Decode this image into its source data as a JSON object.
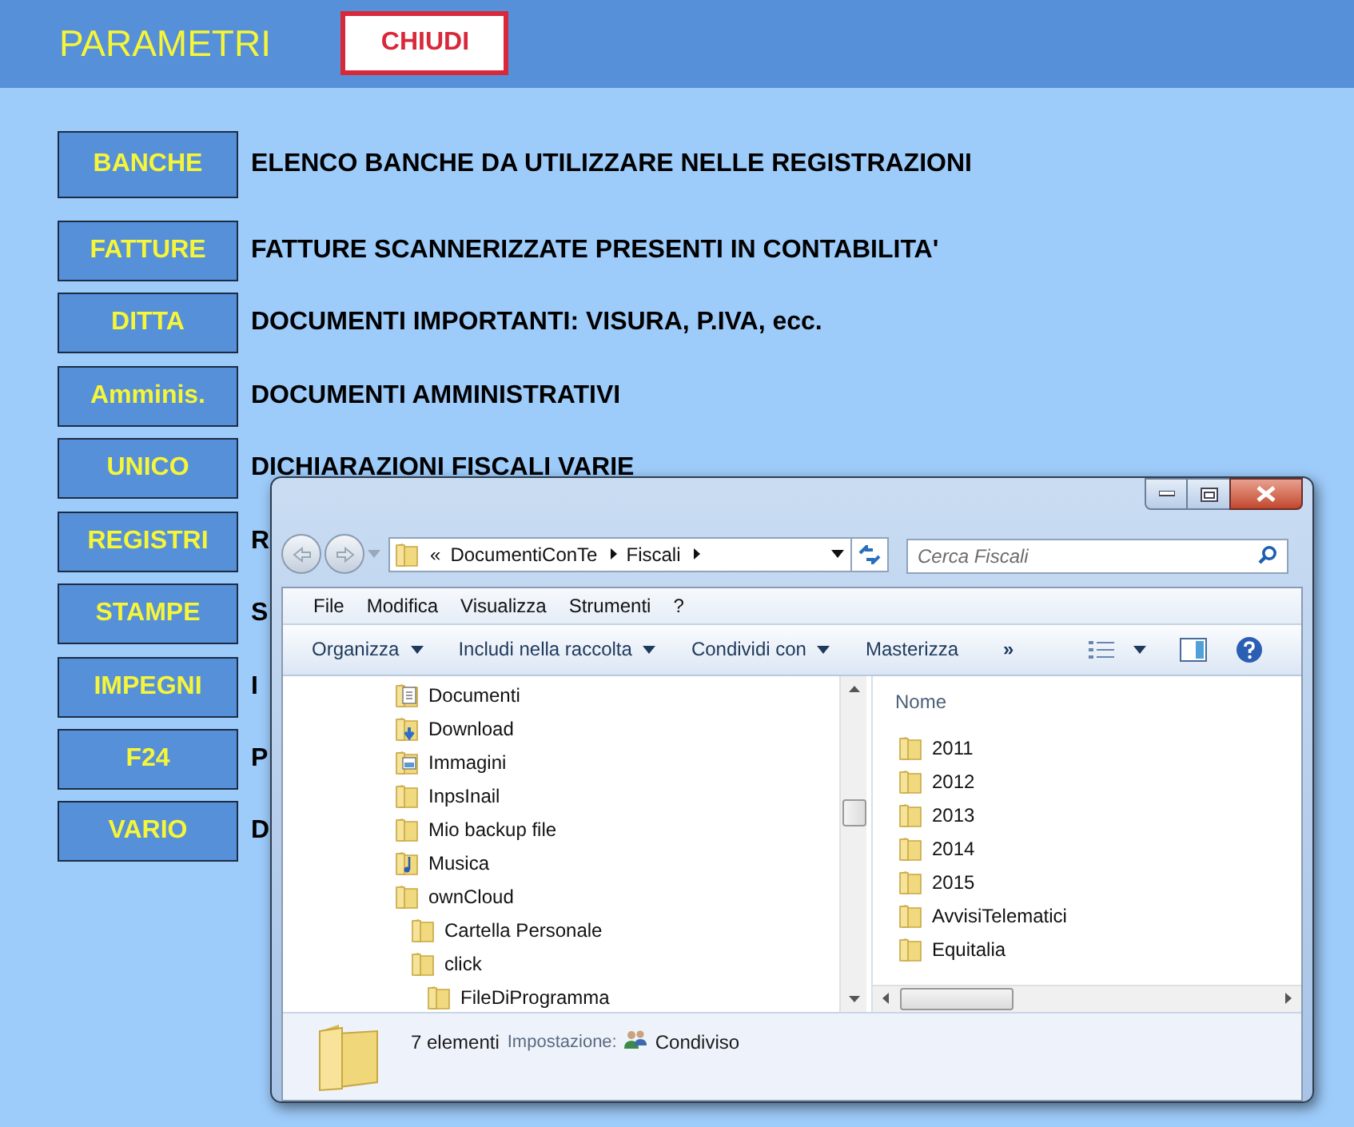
{
  "header": {
    "title": "PARAMETRI",
    "close_button": "CHIUDI"
  },
  "sections": [
    {
      "button": "BANCHE",
      "description": "ELENCO BANCHE DA UTILIZZARE NELLE REGISTRAZIONI"
    },
    {
      "button": "FATTURE",
      "description": "FATTURE SCANNERIZZATE PRESENTI IN CONTABILITA'"
    },
    {
      "button": "DITTA",
      "description": "DOCUMENTI IMPORTANTI: VISURA, P.IVA, ecc."
    },
    {
      "button": "Amminis.",
      "description": "DOCUMENTI AMMINISTRATIVI"
    },
    {
      "button": "UNICO",
      "description": "DICHIARAZIONI FISCALI VARIE"
    },
    {
      "button": "REGISTRI",
      "description": "R"
    },
    {
      "button": "STAMPE",
      "description": "S"
    },
    {
      "button": "IMPEGNI",
      "description": "I"
    },
    {
      "button": "F24",
      "description": "P"
    },
    {
      "button": "VARIO",
      "description": "D"
    }
  ],
  "explorer": {
    "breadcrumb": {
      "overflow": "«",
      "segments": [
        "DocumentiConTe",
        "Fiscali"
      ]
    },
    "search": {
      "placeholder": "Cerca Fiscali"
    },
    "menu": [
      "File",
      "Modifica",
      "Visualizza",
      "Strumenti",
      "?"
    ],
    "toolbar": [
      {
        "label": "Organizza",
        "dropdown": true
      },
      {
        "label": "Includi nella raccolta",
        "dropdown": true
      },
      {
        "label": "Condividi con",
        "dropdown": true
      },
      {
        "label": "Masterizza",
        "dropdown": false
      }
    ],
    "more": "»",
    "nav_tree": [
      {
        "label": "Documenti",
        "kind": "documents"
      },
      {
        "label": "Download",
        "kind": "downloads"
      },
      {
        "label": "Immagini",
        "kind": "pictures"
      },
      {
        "label": "InpsInail",
        "kind": "folder"
      },
      {
        "label": "Mio backup file",
        "kind": "folder"
      },
      {
        "label": "Musica",
        "kind": "music"
      },
      {
        "label": "ownCloud",
        "kind": "folder",
        "children": [
          {
            "label": "Cartella Personale"
          },
          {
            "label": "click",
            "children": [
              {
                "label": "FileDiProgramma"
              }
            ]
          }
        ]
      }
    ],
    "column_header": "Nome",
    "files": [
      "2011",
      "2012",
      "2013",
      "2014",
      "2015",
      "AvvisiTelematici",
      "Equitalia"
    ],
    "details": {
      "count": "7 elementi",
      "setting_label": "Impostazione:",
      "setting_value": "Condiviso"
    }
  }
}
